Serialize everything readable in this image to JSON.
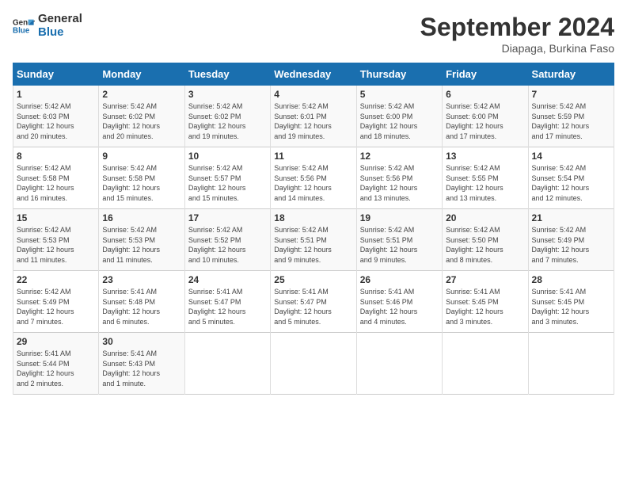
{
  "header": {
    "logo_line1": "General",
    "logo_line2": "Blue",
    "month_title": "September 2024",
    "location": "Diapaga, Burkina Faso"
  },
  "days_of_week": [
    "Sunday",
    "Monday",
    "Tuesday",
    "Wednesday",
    "Thursday",
    "Friday",
    "Saturday"
  ],
  "weeks": [
    [
      {
        "day": "1",
        "sunrise": "5:42 AM",
        "sunset": "6:03 PM",
        "daylight": "12 hours and 20 minutes."
      },
      {
        "day": "2",
        "sunrise": "5:42 AM",
        "sunset": "6:02 PM",
        "daylight": "12 hours and 20 minutes."
      },
      {
        "day": "3",
        "sunrise": "5:42 AM",
        "sunset": "6:02 PM",
        "daylight": "12 hours and 19 minutes."
      },
      {
        "day": "4",
        "sunrise": "5:42 AM",
        "sunset": "6:01 PM",
        "daylight": "12 hours and 19 minutes."
      },
      {
        "day": "5",
        "sunrise": "5:42 AM",
        "sunset": "6:00 PM",
        "daylight": "12 hours and 18 minutes."
      },
      {
        "day": "6",
        "sunrise": "5:42 AM",
        "sunset": "6:00 PM",
        "daylight": "12 hours and 17 minutes."
      },
      {
        "day": "7",
        "sunrise": "5:42 AM",
        "sunset": "5:59 PM",
        "daylight": "12 hours and 17 minutes."
      }
    ],
    [
      {
        "day": "8",
        "sunrise": "5:42 AM",
        "sunset": "5:58 PM",
        "daylight": "12 hours and 16 minutes."
      },
      {
        "day": "9",
        "sunrise": "5:42 AM",
        "sunset": "5:58 PM",
        "daylight": "12 hours and 15 minutes."
      },
      {
        "day": "10",
        "sunrise": "5:42 AM",
        "sunset": "5:57 PM",
        "daylight": "12 hours and 15 minutes."
      },
      {
        "day": "11",
        "sunrise": "5:42 AM",
        "sunset": "5:56 PM",
        "daylight": "12 hours and 14 minutes."
      },
      {
        "day": "12",
        "sunrise": "5:42 AM",
        "sunset": "5:56 PM",
        "daylight": "12 hours and 13 minutes."
      },
      {
        "day": "13",
        "sunrise": "5:42 AM",
        "sunset": "5:55 PM",
        "daylight": "12 hours and 13 minutes."
      },
      {
        "day": "14",
        "sunrise": "5:42 AM",
        "sunset": "5:54 PM",
        "daylight": "12 hours and 12 minutes."
      }
    ],
    [
      {
        "day": "15",
        "sunrise": "5:42 AM",
        "sunset": "5:53 PM",
        "daylight": "12 hours and 11 minutes."
      },
      {
        "day": "16",
        "sunrise": "5:42 AM",
        "sunset": "5:53 PM",
        "daylight": "12 hours and 11 minutes."
      },
      {
        "day": "17",
        "sunrise": "5:42 AM",
        "sunset": "5:52 PM",
        "daylight": "12 hours and 10 minutes."
      },
      {
        "day": "18",
        "sunrise": "5:42 AM",
        "sunset": "5:51 PM",
        "daylight": "12 hours and 9 minutes."
      },
      {
        "day": "19",
        "sunrise": "5:42 AM",
        "sunset": "5:51 PM",
        "daylight": "12 hours and 9 minutes."
      },
      {
        "day": "20",
        "sunrise": "5:42 AM",
        "sunset": "5:50 PM",
        "daylight": "12 hours and 8 minutes."
      },
      {
        "day": "21",
        "sunrise": "5:42 AM",
        "sunset": "5:49 PM",
        "daylight": "12 hours and 7 minutes."
      }
    ],
    [
      {
        "day": "22",
        "sunrise": "5:42 AM",
        "sunset": "5:49 PM",
        "daylight": "12 hours and 7 minutes."
      },
      {
        "day": "23",
        "sunrise": "5:41 AM",
        "sunset": "5:48 PM",
        "daylight": "12 hours and 6 minutes."
      },
      {
        "day": "24",
        "sunrise": "5:41 AM",
        "sunset": "5:47 PM",
        "daylight": "12 hours and 5 minutes."
      },
      {
        "day": "25",
        "sunrise": "5:41 AM",
        "sunset": "5:47 PM",
        "daylight": "12 hours and 5 minutes."
      },
      {
        "day": "26",
        "sunrise": "5:41 AM",
        "sunset": "5:46 PM",
        "daylight": "12 hours and 4 minutes."
      },
      {
        "day": "27",
        "sunrise": "5:41 AM",
        "sunset": "5:45 PM",
        "daylight": "12 hours and 3 minutes."
      },
      {
        "day": "28",
        "sunrise": "5:41 AM",
        "sunset": "5:45 PM",
        "daylight": "12 hours and 3 minutes."
      }
    ],
    [
      {
        "day": "29",
        "sunrise": "5:41 AM",
        "sunset": "5:44 PM",
        "daylight": "12 hours and 2 minutes."
      },
      {
        "day": "30",
        "sunrise": "5:41 AM",
        "sunset": "5:43 PM",
        "daylight": "12 hours and 1 minute."
      },
      null,
      null,
      null,
      null,
      null
    ]
  ],
  "labels": {
    "sunrise": "Sunrise:",
    "sunset": "Sunset:",
    "daylight": "Daylight:"
  }
}
